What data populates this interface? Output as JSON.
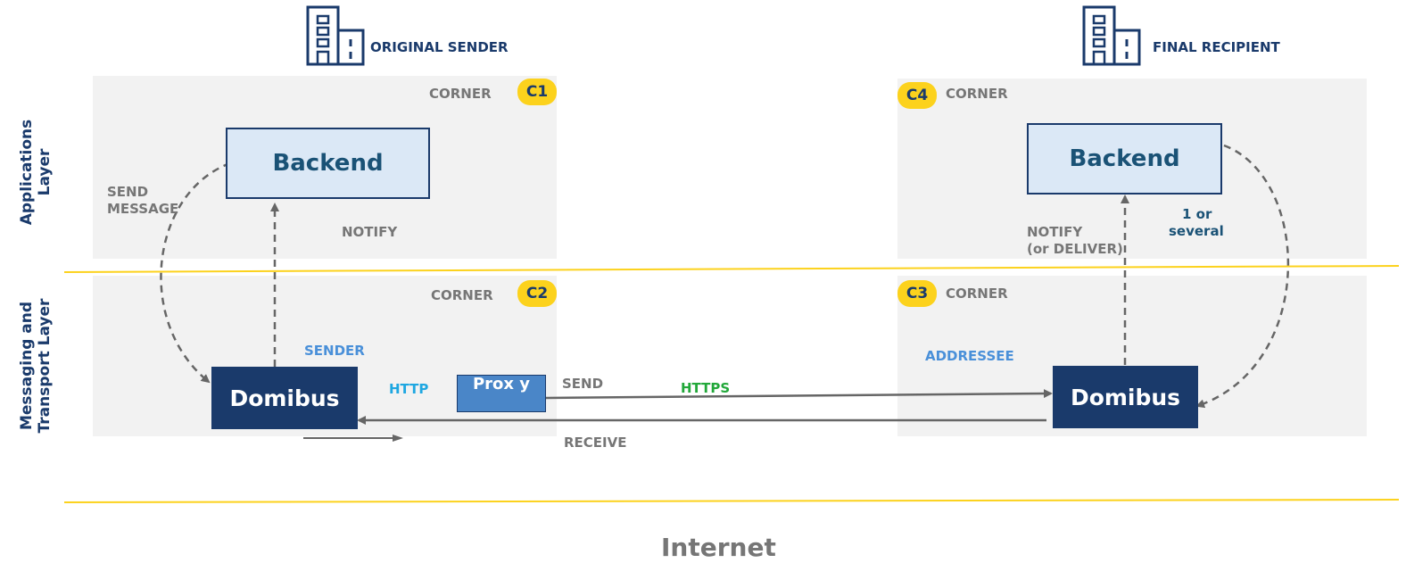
{
  "header": {
    "left_title": "ORIGINAL SENDER",
    "right_title": "FINAL RECIPIENT"
  },
  "layers": {
    "applications": "Applications Layer",
    "messaging": "Messaging and Transport Layer"
  },
  "corners": {
    "c1": {
      "badge": "C1",
      "label": "CORNER"
    },
    "c2": {
      "badge": "C2",
      "label": "CORNER"
    },
    "c3": {
      "badge": "C3",
      "label": "CORNER"
    },
    "c4": {
      "badge": "C4",
      "label": "CORNER"
    }
  },
  "nodes": {
    "backend_left": "Backend",
    "backend_right": "Backend",
    "domibus_left": "Domibus",
    "domibus_right": "Domibus",
    "proxy": "Prox y"
  },
  "edges": {
    "send_message": "SEND MESSAGE",
    "notify_left": "NOTIFY",
    "notify_right_line1": "NOTIFY",
    "notify_right_line2": "(or DELIVER)",
    "one_or_several_line1": "1 or",
    "one_or_several_line2": "several",
    "sender": "SENDER",
    "addressee": "ADDRESSEE",
    "http": "HTTP",
    "send": "SEND",
    "https": "HTTPS",
    "receive": "RECEIVE"
  },
  "footer": {
    "internet": "Internet"
  },
  "colors": {
    "navy": "#1a3a6b",
    "backend_fill": "#dbe8f6",
    "panel": "#f2f2f2",
    "yellow": "#fcd21d",
    "gray_text": "#767676",
    "light_blue_text": "#4a90d9",
    "http_blue": "#1ea7e1",
    "https_green": "#22a83a"
  },
  "icons": [
    "building-icon"
  ]
}
